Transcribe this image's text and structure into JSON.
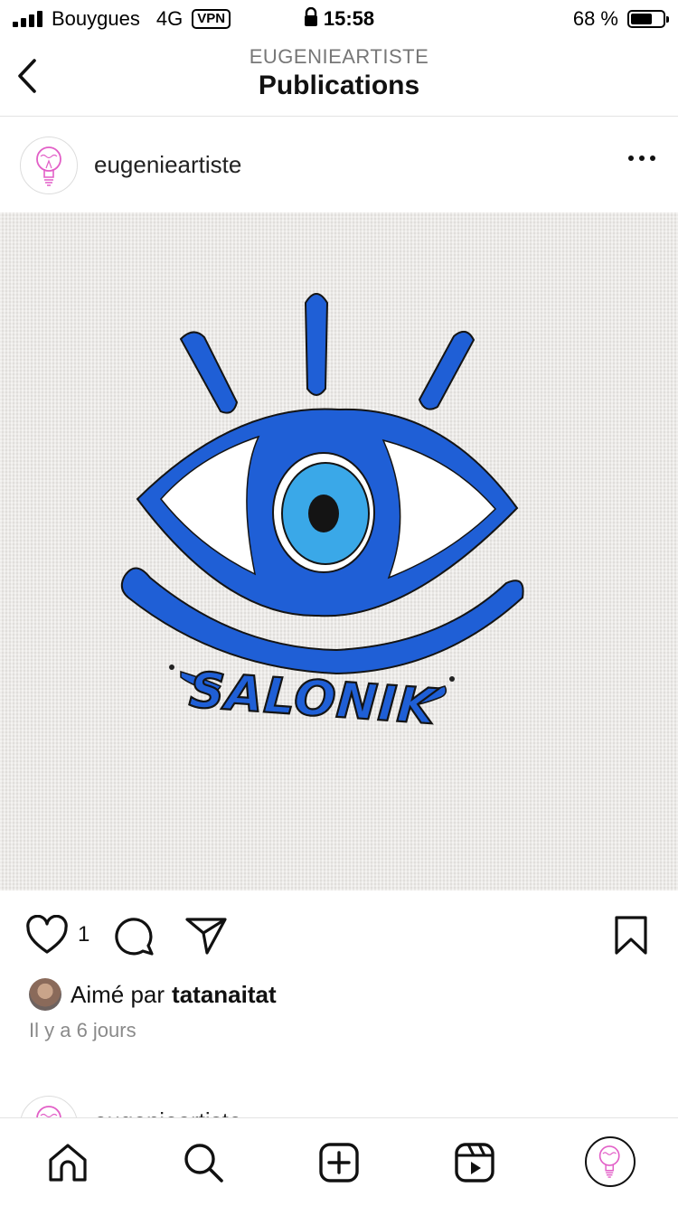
{
  "status_bar": {
    "carrier": "Bouygues",
    "network": "4G",
    "vpn": "VPN",
    "time": "15:58",
    "battery": "68 %",
    "battery_level": 0.68
  },
  "header": {
    "subtitle": "EUGENIEARTISTE",
    "title": "Publications"
  },
  "post": {
    "username": "eugenieartiste",
    "image_text": "SALONIK",
    "like_count": "1",
    "liked_by_prefix": "Aimé par",
    "liked_by_user": "tatanaitat",
    "timestamp": "Il y a 6 jours"
  },
  "next_post": {
    "username": "eugenieartiste"
  },
  "colors": {
    "eye_blue": "#1f5fd6",
    "iris_light": "#3aa8e8",
    "logo_pink": "#e25fc7"
  },
  "icons": [
    "back-icon",
    "more-icon",
    "heart-icon",
    "comment-icon",
    "share-icon",
    "bookmark-icon",
    "home-icon",
    "search-icon",
    "new-post-icon",
    "reels-icon"
  ]
}
